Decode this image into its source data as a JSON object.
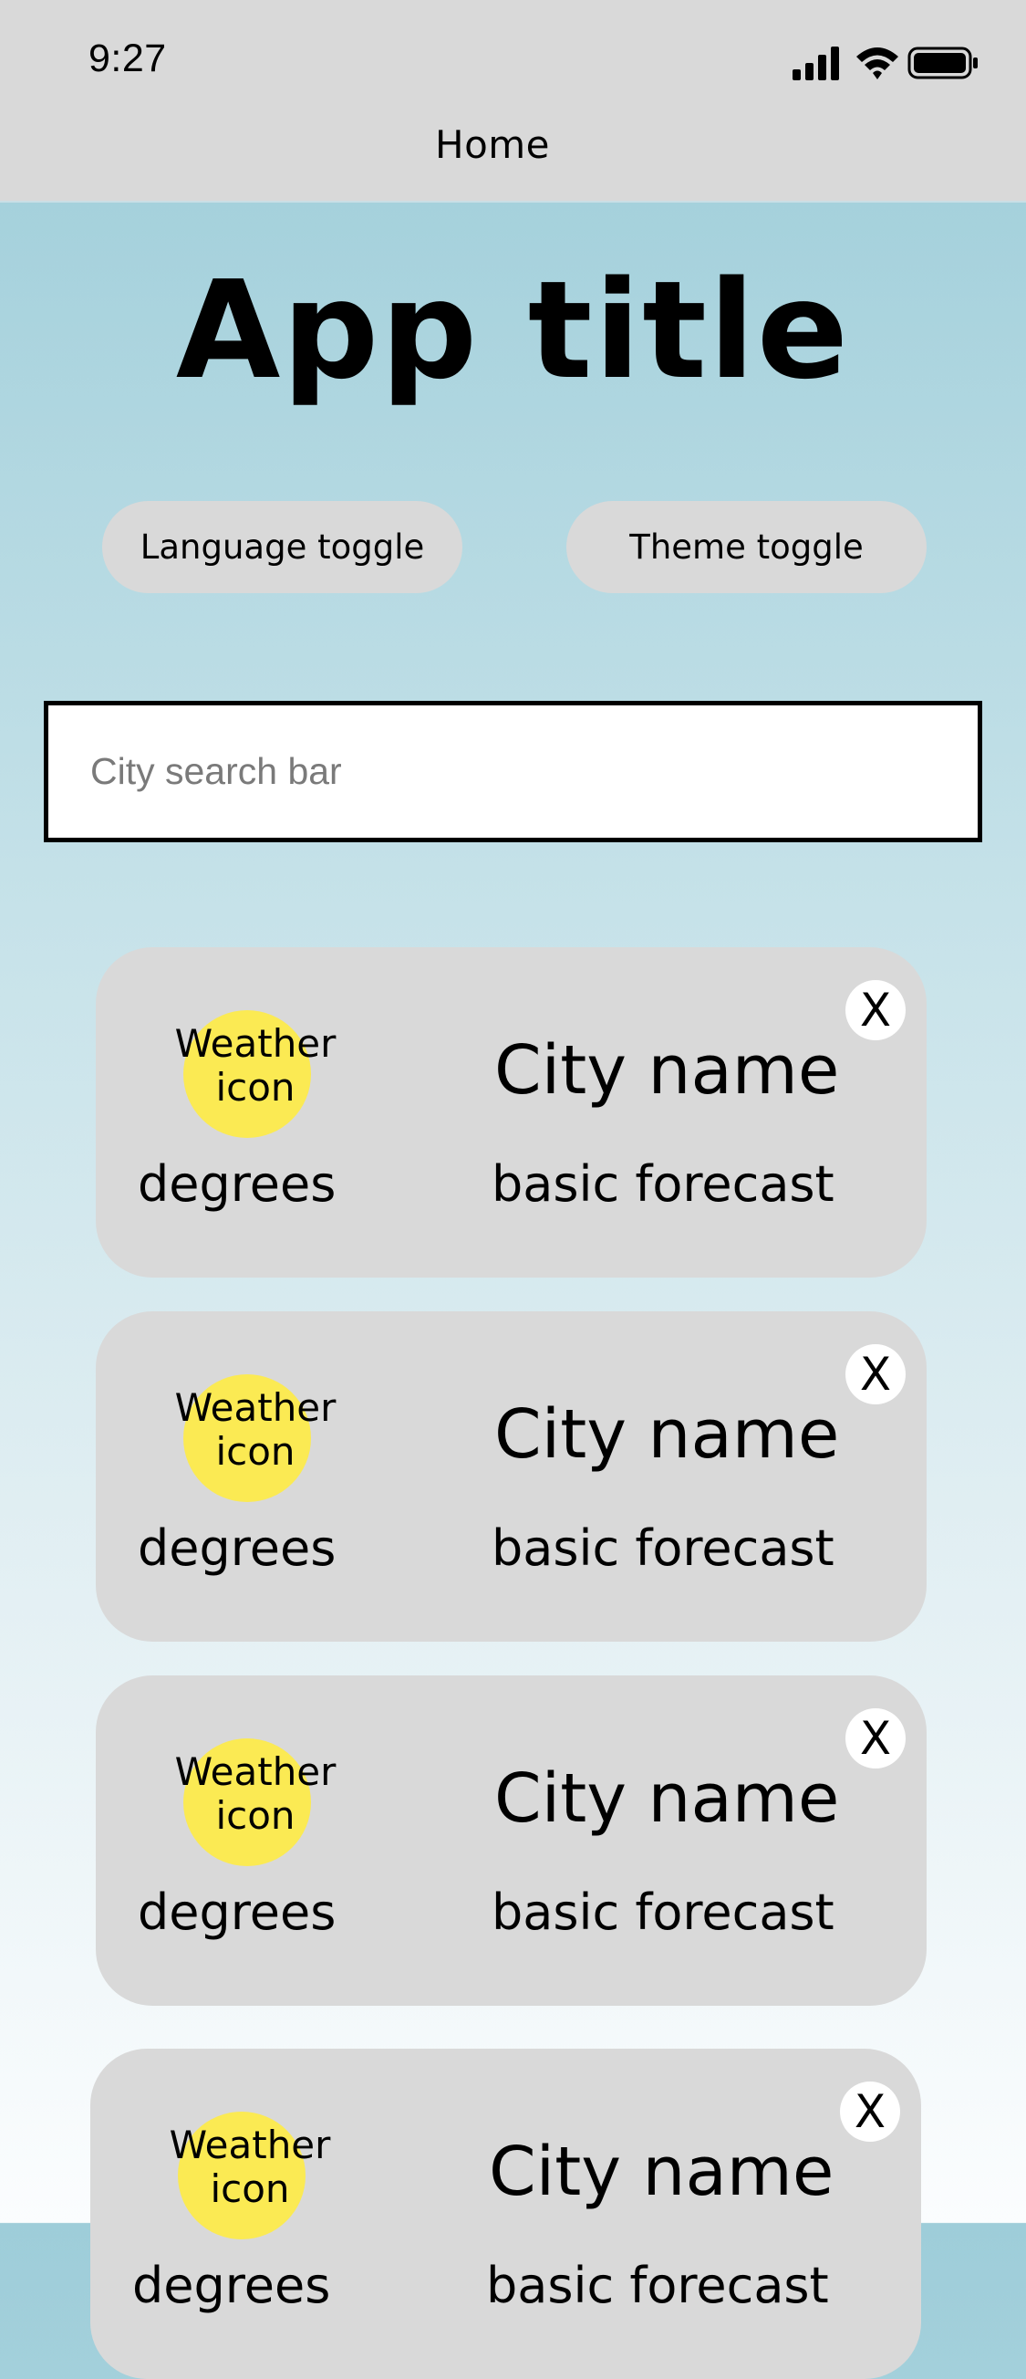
{
  "status_bar": {
    "time": "9:27"
  },
  "nav": {
    "title": "Home"
  },
  "app": {
    "title": "App title"
  },
  "toggles": {
    "language": "Language toggle",
    "theme": "Theme toggle"
  },
  "search": {
    "placeholder": "City search bar",
    "value": ""
  },
  "cards": [
    {
      "weather_icon": "Weather icon",
      "degrees": "degrees",
      "city": "City name",
      "forecast": "basic forecast",
      "close": "X"
    },
    {
      "weather_icon": "Weather icon",
      "degrees": "degrees",
      "city": "City name",
      "forecast": "basic forecast",
      "close": "X"
    },
    {
      "weather_icon": "Weather icon",
      "degrees": "degrees",
      "city": "City name",
      "forecast": "basic forecast",
      "close": "X"
    },
    {
      "weather_icon": "Weather icon",
      "degrees": "degrees",
      "city": "City name",
      "forecast": "basic forecast",
      "close": "X"
    }
  ],
  "icons": {
    "signal": "cellular-signal-icon",
    "wifi": "wifi-icon",
    "battery": "battery-icon",
    "weather": "sun-icon"
  },
  "colors": {
    "topbar": "#d9d9d9",
    "card": "#d9d9d9",
    "sun": "#fbea53",
    "background_top": "#9ecdd9",
    "background_bottom": "#fbfdfe"
  }
}
